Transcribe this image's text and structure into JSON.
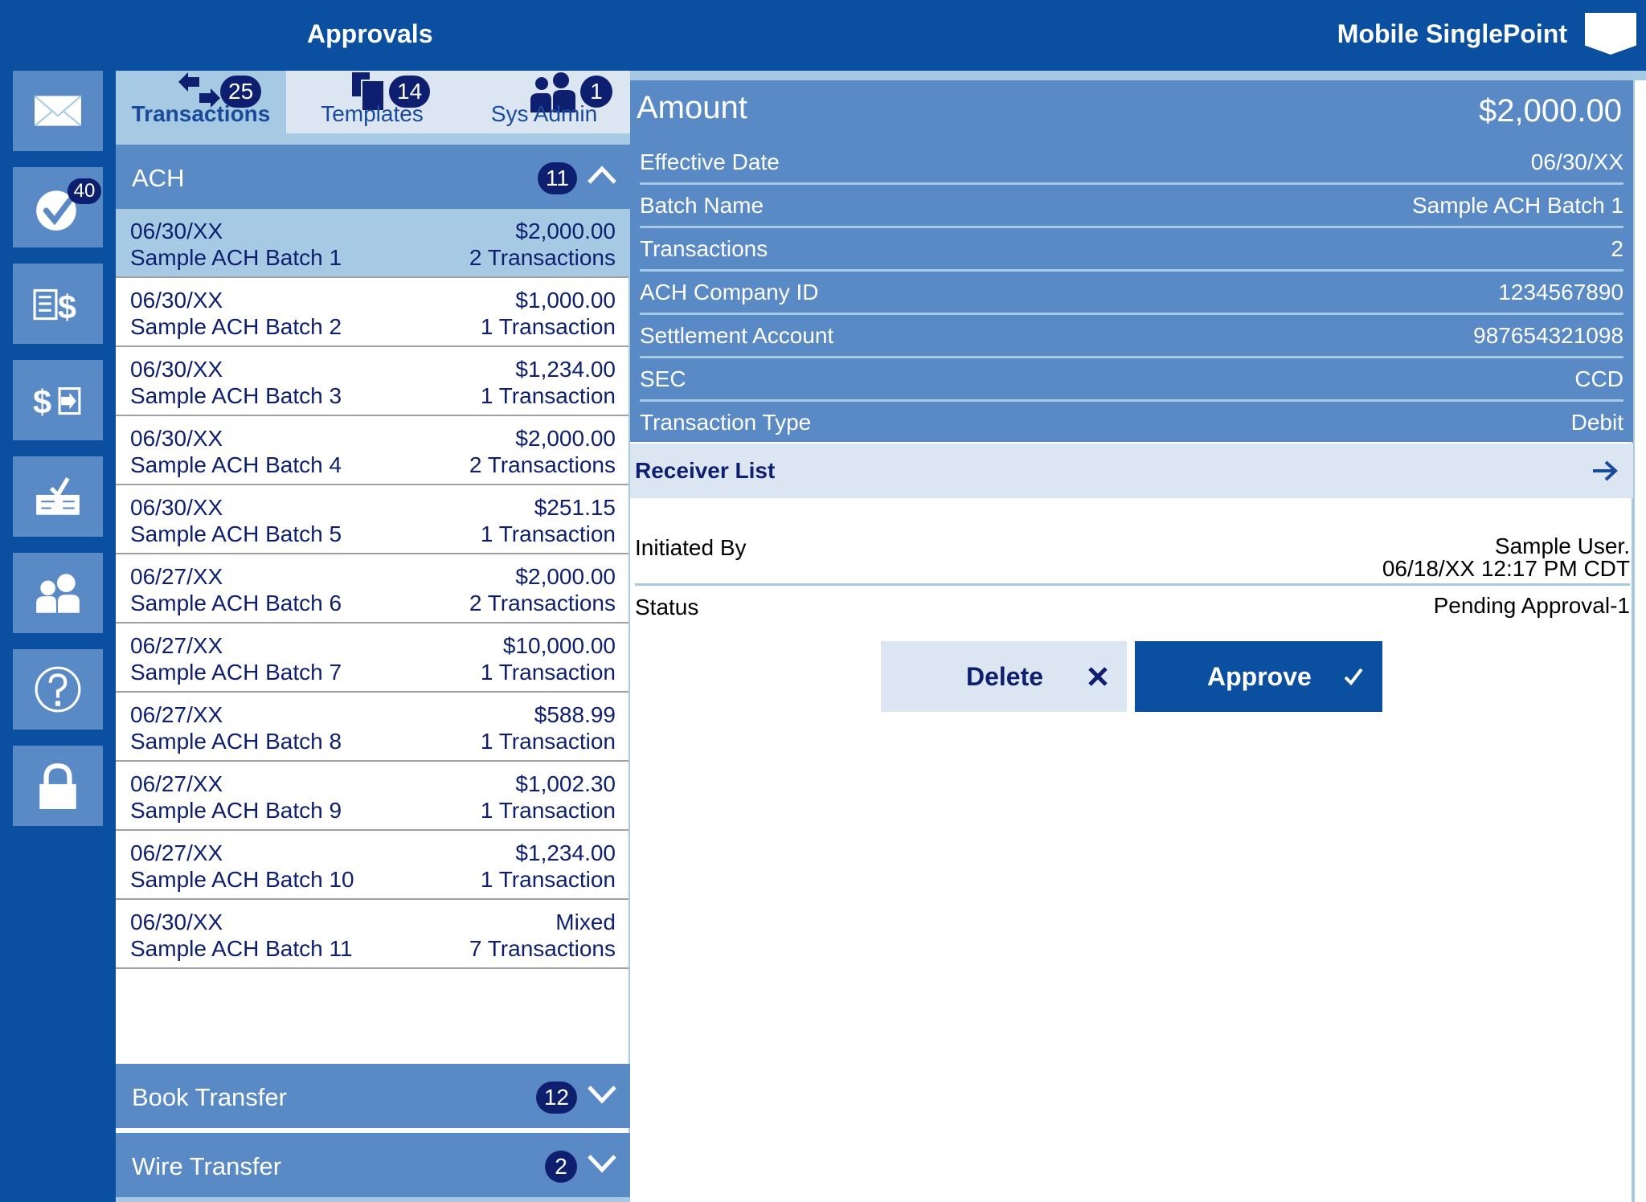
{
  "header": {
    "title": "Approvals",
    "brand": "Mobile SinglePoint"
  },
  "colors": {
    "primary": "#0B4FA0",
    "tile": "#5A8AC6",
    "light": "#A6CAE3",
    "pale": "#DCE6F3",
    "navy": "#0D1F6E"
  },
  "rail": {
    "items": [
      {
        "name": "messages",
        "icon": "envelope-icon"
      },
      {
        "name": "approvals",
        "icon": "check-circle-icon",
        "badge": "40"
      },
      {
        "name": "statements",
        "icon": "document-dollar-icon"
      },
      {
        "name": "transfers",
        "icon": "dollar-transfer-icon"
      },
      {
        "name": "positive-pay",
        "icon": "check-deposit-icon"
      },
      {
        "name": "users",
        "icon": "users-icon"
      },
      {
        "name": "help",
        "icon": "help-circle-icon"
      },
      {
        "name": "logout",
        "icon": "lock-icon"
      }
    ]
  },
  "tabs": [
    {
      "label": "Transactions",
      "count": "25",
      "icon": "arrows-exchange-icon",
      "active": true
    },
    {
      "label": "Templates",
      "count": "14",
      "icon": "copy-pages-icon",
      "active": false
    },
    {
      "label": "Sys Admin",
      "count": "1",
      "icon": "users-icon",
      "active": false
    }
  ],
  "sections": {
    "ach": {
      "label": "ACH",
      "count": "11",
      "expanded": true
    },
    "book": {
      "label": "Book Transfer",
      "count": "12",
      "expanded": false
    },
    "wire": {
      "label": "Wire Transfer",
      "count": "2",
      "expanded": false
    }
  },
  "batches": [
    {
      "date": "06/30/XX",
      "name": "Sample ACH Batch 1",
      "amount": "$2,000.00",
      "count": "2 Transactions",
      "selected": true
    },
    {
      "date": "06/30/XX",
      "name": "Sample ACH Batch 2",
      "amount": "$1,000.00",
      "count": "1 Transaction"
    },
    {
      "date": "06/30/XX",
      "name": "Sample ACH Batch 3",
      "amount": "$1,234.00",
      "count": "1 Transaction"
    },
    {
      "date": "06/30/XX",
      "name": "Sample ACH Batch 4",
      "amount": "$2,000.00",
      "count": "2 Transactions"
    },
    {
      "date": "06/30/XX",
      "name": "Sample ACH Batch 5",
      "amount": "$251.15",
      "count": "1 Transaction"
    },
    {
      "date": "06/27/XX",
      "name": "Sample ACH Batch 6",
      "amount": "$2,000.00",
      "count": "2 Transactions"
    },
    {
      "date": "06/27/XX",
      "name": "Sample ACH Batch 7",
      "amount": "$10,000.00",
      "count": "1 Transaction"
    },
    {
      "date": "06/27/XX",
      "name": "Sample ACH Batch 8",
      "amount": "$588.99",
      "count": "1 Transaction"
    },
    {
      "date": "06/27/XX",
      "name": "Sample ACH Batch 9",
      "amount": "$1,002.30",
      "count": "1 Transaction"
    },
    {
      "date": "06/27/XX",
      "name": "Sample ACH Batch 10",
      "amount": "$1,234.00",
      "count": "1 Transaction"
    },
    {
      "date": "06/30/XX",
      "name": "Sample ACH Batch 11",
      "amount": "Mixed",
      "count": "7 Transactions"
    }
  ],
  "detail": {
    "amount_label": "Amount",
    "amount_value": "$2,000.00",
    "fields": [
      {
        "label": "Effective Date",
        "value": "06/30/XX"
      },
      {
        "label": "Batch Name",
        "value": "Sample ACH Batch 1"
      },
      {
        "label": "Transactions",
        "value": "2"
      },
      {
        "label": "ACH Company ID",
        "value": "1234567890"
      },
      {
        "label": "Settlement Account",
        "value": "987654321098"
      },
      {
        "label": "SEC",
        "value": "CCD"
      },
      {
        "label": "Transaction Type",
        "value": "Debit"
      }
    ],
    "receiver_list_label": "Receiver List",
    "initiated_by_label": "Initiated By",
    "initiated_by_user": "Sample User.",
    "initiated_by_time": "06/18/XX 12:17 PM CDT",
    "status_label": "Status",
    "status_value": "Pending Approval-1"
  },
  "actions": {
    "delete_label": "Delete",
    "approve_label": "Approve"
  }
}
